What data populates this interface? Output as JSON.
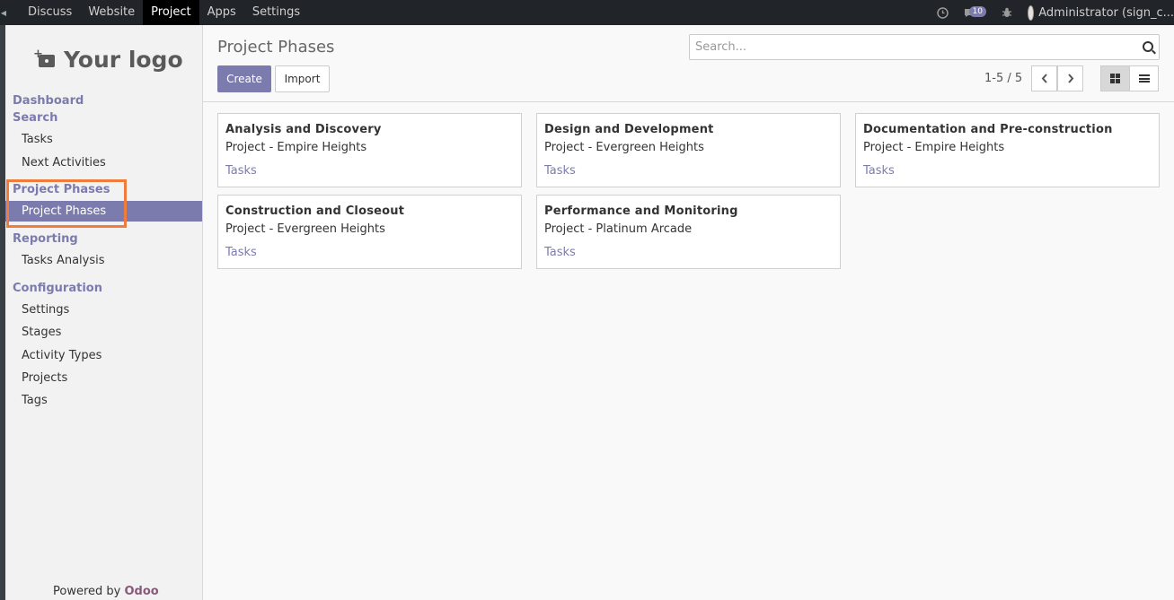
{
  "topnav": {
    "items": [
      "Discuss",
      "Website",
      "Project",
      "Apps",
      "Settings"
    ],
    "active_index": 2,
    "badge_count": "10",
    "user": "Administrator (sign_c..."
  },
  "sidebar": {
    "logo": "Your logo",
    "sections": [
      {
        "label": "Dashboard",
        "items": []
      },
      {
        "label": "Search",
        "items": [
          "Tasks",
          "Next Activities"
        ]
      },
      {
        "label": "Project Phases",
        "items": [
          "Project Phases"
        ]
      },
      {
        "label": "Reporting",
        "items": [
          "Tasks Analysis"
        ]
      },
      {
        "label": "Configuration",
        "items": [
          "Settings",
          "Stages",
          "Activity Types",
          "Projects",
          "Tags"
        ]
      }
    ],
    "powered_prefix": "Powered by",
    "powered_brand": "Odoo"
  },
  "control": {
    "title": "Project Phases",
    "create_label": "Create",
    "import_label": "Import",
    "search_placeholder": "Search...",
    "pager": "1-5 / 5"
  },
  "cards": [
    {
      "title": "Analysis and Discovery",
      "subtitle": "Project - Empire Heights",
      "link": "Tasks"
    },
    {
      "title": "Design and Development",
      "subtitle": "Project - Evergreen Heights",
      "link": "Tasks"
    },
    {
      "title": "Documentation and Pre-construction",
      "subtitle": "Project - Empire Heights",
      "link": "Tasks"
    },
    {
      "title": "Construction and Closeout",
      "subtitle": "Project - Evergreen Heights",
      "link": "Tasks"
    },
    {
      "title": "Performance and Monitoring",
      "subtitle": "Project - Platinum Arcade",
      "link": "Tasks"
    }
  ],
  "colors": {
    "brand": "#7c7bad",
    "topbar": "#212529",
    "highlight": "#f07c3c"
  }
}
